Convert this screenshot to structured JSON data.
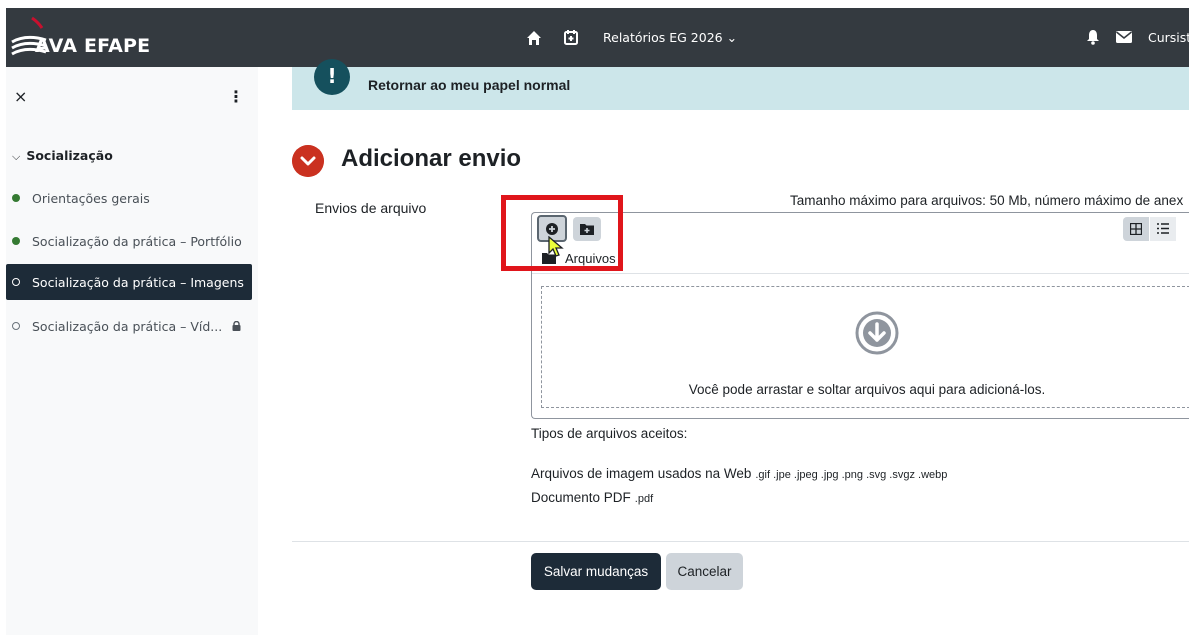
{
  "navbar": {
    "brand": "AVA EFAPE",
    "course_menu": "Relatórios EG 2026 ⌄",
    "user": "Cursist",
    "icons": [
      "home-icon",
      "calendar-icon",
      "bell-icon",
      "envelope-icon"
    ]
  },
  "drawer": {
    "close": "×",
    "more": "⋮",
    "section": "Socialização",
    "items": [
      {
        "label": "Orientações gerais",
        "status": "done"
      },
      {
        "label": "Socialização da prática – Portfólio",
        "status": "done"
      },
      {
        "label": "Socialização da prática – Imagens",
        "status": "active"
      },
      {
        "label": "Socialização da prática – Víd...",
        "status": "locked"
      }
    ]
  },
  "alert": {
    "icon": "!",
    "text": "Retornar ao meu papel normal"
  },
  "page": {
    "title": "Adicionar envio",
    "field_label": "Envios de arquivo",
    "max_info": "Tamanho máximo para arquivos: 50 Mb, número máximo de anex",
    "folder_label": "Arquivos",
    "drop_text": "Você pode arrastar e soltar arquivos aqui para adicioná-los.",
    "accepted_title": "Tipos de arquivos aceitos:",
    "accepted": [
      {
        "name": "Arquivos de imagem usados na Web",
        "ext": ".gif .jpe .jpeg .jpg .png .svg .svgz .webp"
      },
      {
        "name": "Documento PDF",
        "ext": ".pdf"
      }
    ],
    "save": "Salvar mudanças",
    "cancel": "Cancelar"
  },
  "colors": {
    "navbar": "#343a40",
    "active_item": "#1d2b38",
    "alert_bg": "#cce6ea",
    "heading_icon": "#ca3120",
    "highlight": "#e0151b",
    "done_dot": "#357a32"
  }
}
